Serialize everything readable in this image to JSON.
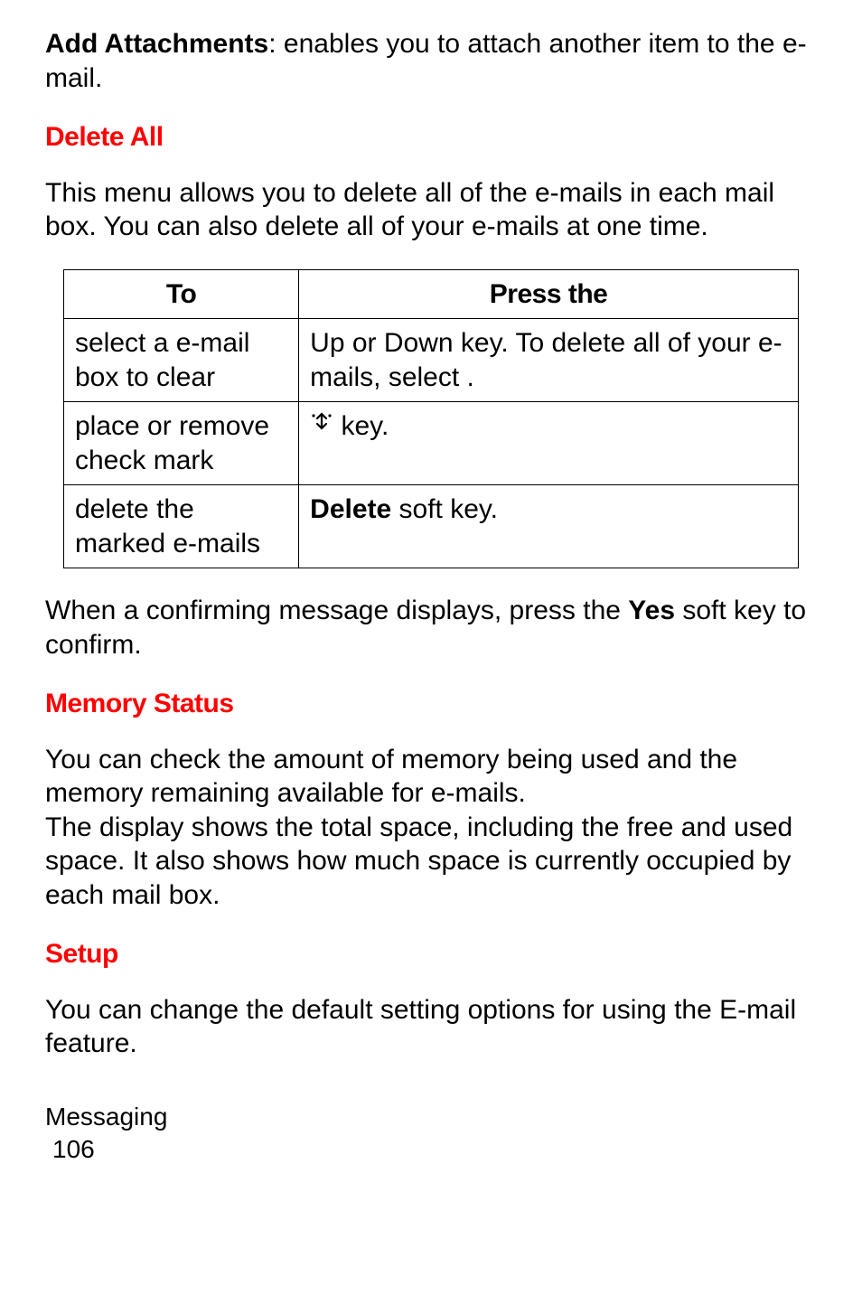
{
  "intro": {
    "boldLead": "Add Attachments",
    "rest": ": enables you to attach another item to the e-mail."
  },
  "deleteAll": {
    "header": "Delete All",
    "para": "This menu allows you to delete all of the e-mails in each mail box. You can also delete all of your e-mails at one time.",
    "tableHeader1": "To",
    "tableHeader2": "Press the",
    "row1_to": "select a e-mail box to clear",
    "row1_press": "Up or Down key. To delete all of your e-mails, select        .",
    "row2_to": "place or remove check mark",
    "row2_press": " key.",
    "row3_to": "delete the marked e-mails",
    "row3_press_bold": "Delete",
    "row3_press_rest": " soft key.",
    "confirm_before": "When a confirming message displays, press the ",
    "confirm_bold": "Yes",
    "confirm_after": " soft key to confirm."
  },
  "memoryStatus": {
    "header": "Memory Status",
    "para": "You can check the amount of memory being used and the memory remaining available for e-mails.\nThe display shows the total space, including the free and used space. It also shows how much space is currently occupied by each mail box."
  },
  "setup": {
    "header": "Setup",
    "para": "You can change the default setting options for using the E-mail feature."
  },
  "footer": {
    "section": "Messaging",
    "page": "106"
  }
}
